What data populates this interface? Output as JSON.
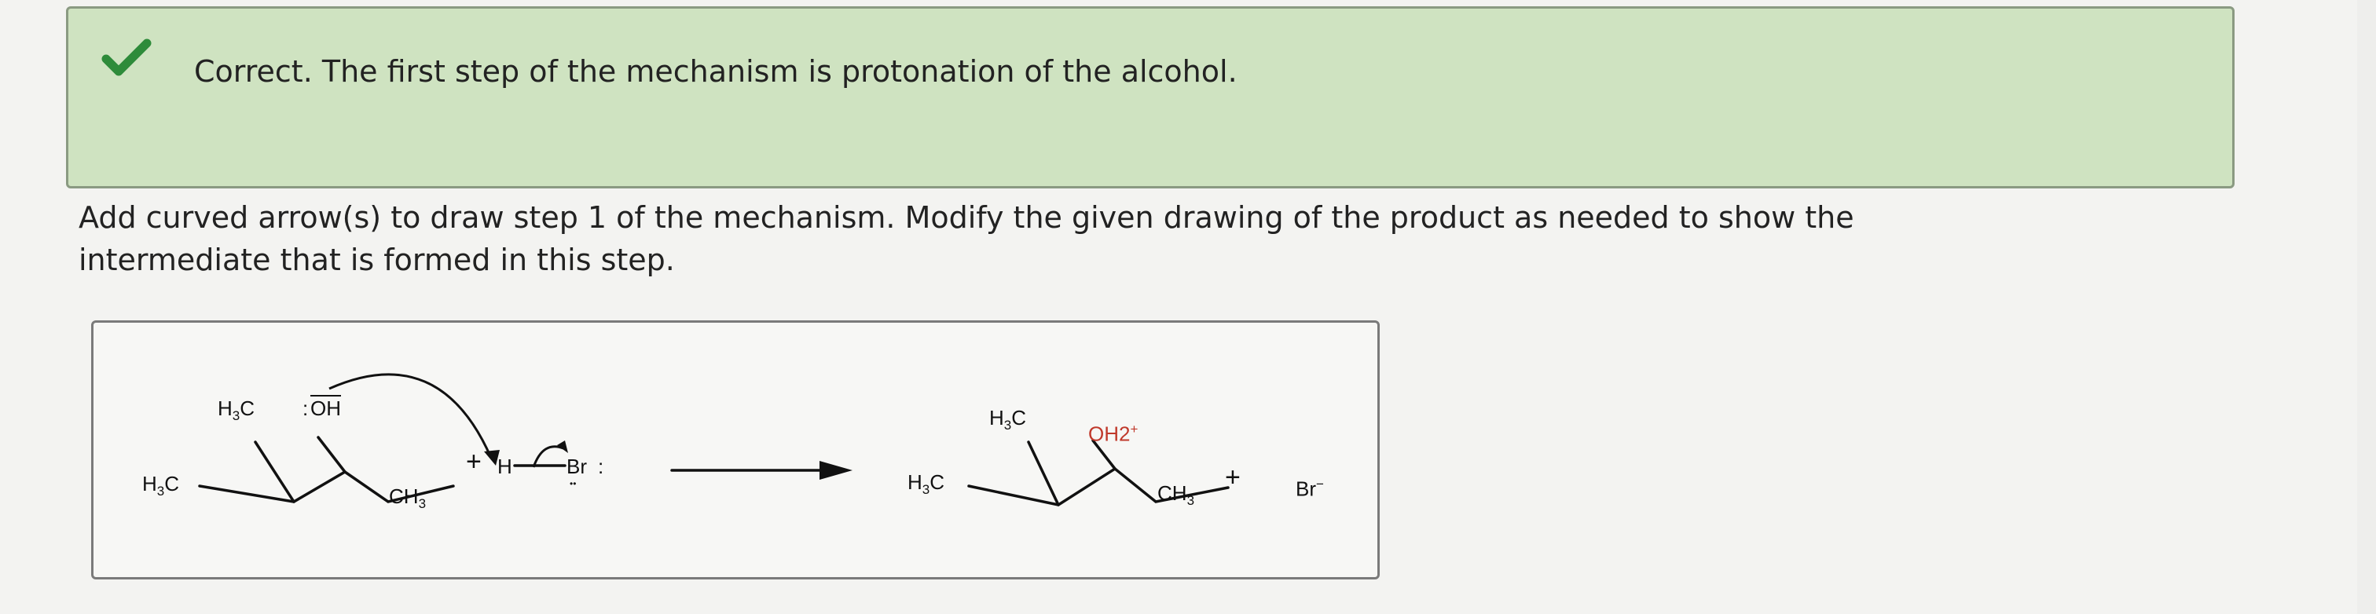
{
  "feedback": {
    "status_icon": "check-icon",
    "status_color": "#2e8b3a",
    "message": "Correct. The first step of the mechanism is protonation of the alcohol."
  },
  "question": {
    "instructions": "Add curved arrow(s) to draw step 1 of the mechanism. Modify the given drawing of the product as needed to show the intermediate that is formed in this step."
  },
  "reaction": {
    "reactant": {
      "methyl_top": "H3C",
      "hydroxyl_lone_pair": ":",
      "hydroxyl": "OH",
      "methyl_left": "H3C",
      "methyl_right": "CH3"
    },
    "plus_1": "+",
    "reagent": {
      "hydrogen": "H",
      "bromine": "Br",
      "lone_pair_right": ":",
      "lone_pair_bottom": "••"
    },
    "product": {
      "methyl_top": "H3C",
      "oxonium": "OH2",
      "oxonium_charge": "+",
      "methyl_left": "H3C",
      "methyl_right": "CH3"
    },
    "plus_2": "+",
    "bromide": "Br",
    "bromide_charge": "−"
  }
}
